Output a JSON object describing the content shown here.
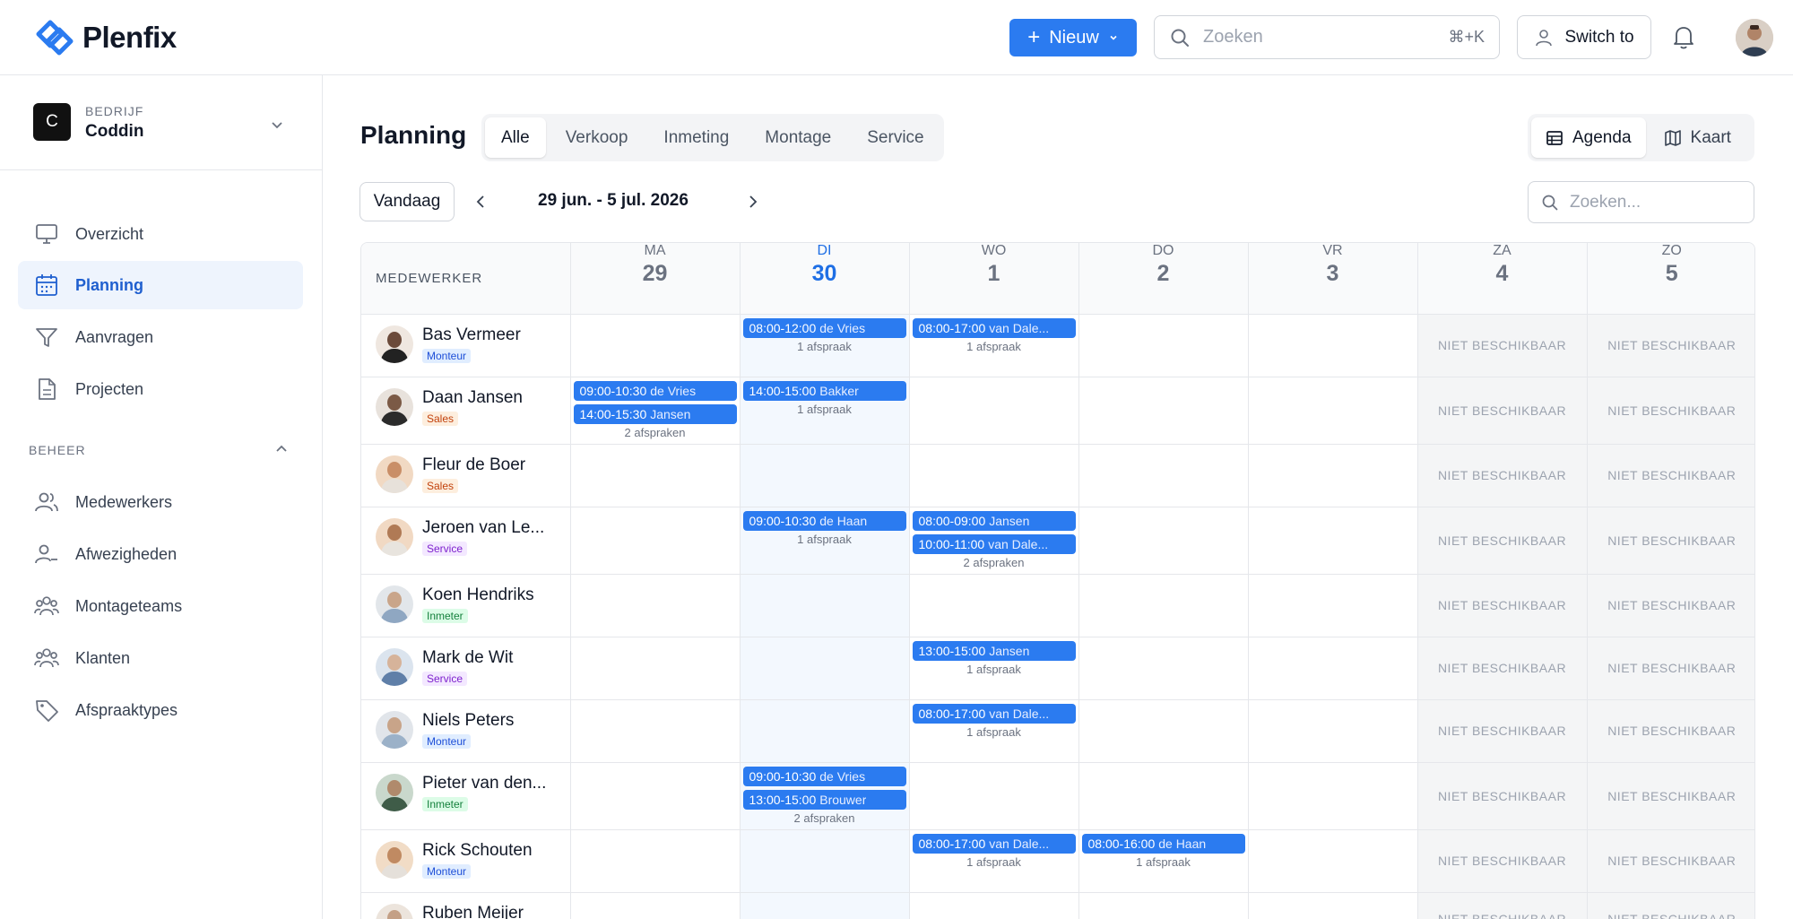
{
  "app": {
    "logo_text": "Plenfix"
  },
  "topbar": {
    "new_label": "Nieuw",
    "search_placeholder": "Zoeken",
    "search_shortcut": "⌘+K",
    "switch_label": "Switch to"
  },
  "company": {
    "kicker": "BEDRIJF",
    "name": "Coddin",
    "initial": "C"
  },
  "sidebar": {
    "items": [
      {
        "label": "Overzicht"
      },
      {
        "label": "Planning"
      },
      {
        "label": "Aanvragen"
      },
      {
        "label": "Projecten"
      }
    ],
    "section_label": "BEHEER",
    "manage_items": [
      {
        "label": "Medewerkers"
      },
      {
        "label": "Afwezigheden"
      },
      {
        "label": "Montageteams"
      },
      {
        "label": "Klanten"
      },
      {
        "label": "Afspraaktypes"
      }
    ]
  },
  "page": {
    "title": "Planning",
    "tabs": [
      "Alle",
      "Verkoop",
      "Inmeting",
      "Montage",
      "Service"
    ],
    "views": [
      "Agenda",
      "Kaart"
    ],
    "today_label": "Vandaag",
    "date_range": "29 jun. - 5 jul. 2026",
    "search_placeholder": "Zoeken..."
  },
  "grid": {
    "employee_header": "MEDEWERKER",
    "unavailable_label": "NIET BESCHIKBAAR",
    "days": [
      {
        "dow": "MA",
        "num": "29"
      },
      {
        "dow": "DI",
        "num": "30"
      },
      {
        "dow": "WO",
        "num": "1"
      },
      {
        "dow": "DO",
        "num": "2"
      },
      {
        "dow": "VR",
        "num": "3"
      },
      {
        "dow": "ZA",
        "num": "4"
      },
      {
        "dow": "ZO",
        "num": "5"
      }
    ],
    "rows": [
      {
        "name": "Bas Vermeer",
        "role": "Monteur",
        "cells": [
          {
            "appts": [],
            "count": ""
          },
          {
            "appts": [
              {
                "time": "08:00-12:00",
                "client": "de Vries"
              }
            ],
            "count": "1 afspraak"
          },
          {
            "appts": [
              {
                "time": "08:00-17:00",
                "client": "van Dale..."
              }
            ],
            "count": "1 afspraak"
          },
          {
            "appts": [],
            "count": ""
          },
          {
            "appts": [],
            "count": ""
          }
        ]
      },
      {
        "name": "Daan Jansen",
        "role": "Sales",
        "cells": [
          {
            "appts": [
              {
                "time": "09:00-10:30",
                "client": "de Vries"
              },
              {
                "time": "14:00-15:30",
                "client": "Jansen"
              }
            ],
            "count": "2 afspraken"
          },
          {
            "appts": [
              {
                "time": "14:00-15:00",
                "client": "Bakker"
              }
            ],
            "count": "1 afspraak"
          },
          {
            "appts": [],
            "count": ""
          },
          {
            "appts": [],
            "count": ""
          },
          {
            "appts": [],
            "count": ""
          }
        ]
      },
      {
        "name": "Fleur de Boer",
        "role": "Sales",
        "cells": [
          {
            "appts": [],
            "count": ""
          },
          {
            "appts": [],
            "count": ""
          },
          {
            "appts": [],
            "count": ""
          },
          {
            "appts": [],
            "count": ""
          },
          {
            "appts": [],
            "count": ""
          }
        ]
      },
      {
        "name": "Jeroen van Le...",
        "role": "Service",
        "cells": [
          {
            "appts": [],
            "count": ""
          },
          {
            "appts": [
              {
                "time": "09:00-10:30",
                "client": "de Haan"
              }
            ],
            "count": "1 afspraak"
          },
          {
            "appts": [
              {
                "time": "08:00-09:00",
                "client": "Jansen"
              },
              {
                "time": "10:00-11:00",
                "client": "van Dale..."
              }
            ],
            "count": "2 afspraken"
          },
          {
            "appts": [],
            "count": ""
          },
          {
            "appts": [],
            "count": ""
          }
        ]
      },
      {
        "name": "Koen Hendriks",
        "role": "Inmeter",
        "cells": [
          {
            "appts": [],
            "count": ""
          },
          {
            "appts": [],
            "count": ""
          },
          {
            "appts": [],
            "count": ""
          },
          {
            "appts": [],
            "count": ""
          },
          {
            "appts": [],
            "count": ""
          }
        ]
      },
      {
        "name": "Mark de Wit",
        "role": "Service",
        "cells": [
          {
            "appts": [],
            "count": ""
          },
          {
            "appts": [],
            "count": ""
          },
          {
            "appts": [
              {
                "time": "13:00-15:00",
                "client": "Jansen"
              }
            ],
            "count": "1 afspraak"
          },
          {
            "appts": [],
            "count": ""
          },
          {
            "appts": [],
            "count": ""
          }
        ]
      },
      {
        "name": "Niels Peters",
        "role": "Monteur",
        "cells": [
          {
            "appts": [],
            "count": ""
          },
          {
            "appts": [],
            "count": ""
          },
          {
            "appts": [
              {
                "time": "08:00-17:00",
                "client": "van Dale..."
              }
            ],
            "count": "1 afspraak"
          },
          {
            "appts": [],
            "count": ""
          },
          {
            "appts": [],
            "count": ""
          }
        ]
      },
      {
        "name": "Pieter van den...",
        "role": "Inmeter",
        "cells": [
          {
            "appts": [],
            "count": ""
          },
          {
            "appts": [
              {
                "time": "09:00-10:30",
                "client": "de Vries"
              },
              {
                "time": "13:00-15:00",
                "client": "Brouwer"
              }
            ],
            "count": "2 afspraken"
          },
          {
            "appts": [],
            "count": ""
          },
          {
            "appts": [],
            "count": ""
          },
          {
            "appts": [],
            "count": ""
          }
        ]
      },
      {
        "name": "Rick Schouten",
        "role": "Monteur",
        "cells": [
          {
            "appts": [],
            "count": ""
          },
          {
            "appts": [],
            "count": ""
          },
          {
            "appts": [
              {
                "time": "08:00-17:00",
                "client": "van Dale..."
              }
            ],
            "count": "1 afspraak"
          },
          {
            "appts": [
              {
                "time": "08:00-16:00",
                "client": "de Haan"
              }
            ],
            "count": "1 afspraak"
          },
          {
            "appts": [],
            "count": ""
          }
        ]
      },
      {
        "name": "Ruben Meijer",
        "role": "",
        "cells": [
          {
            "appts": [],
            "count": ""
          },
          {
            "appts": [],
            "count": ""
          },
          {
            "appts": [],
            "count": ""
          },
          {
            "appts": [],
            "count": ""
          },
          {
            "appts": [],
            "count": ""
          }
        ]
      }
    ]
  },
  "colors": {
    "accent": "#2b7bf0",
    "today_header": "#1f6fe5"
  }
}
